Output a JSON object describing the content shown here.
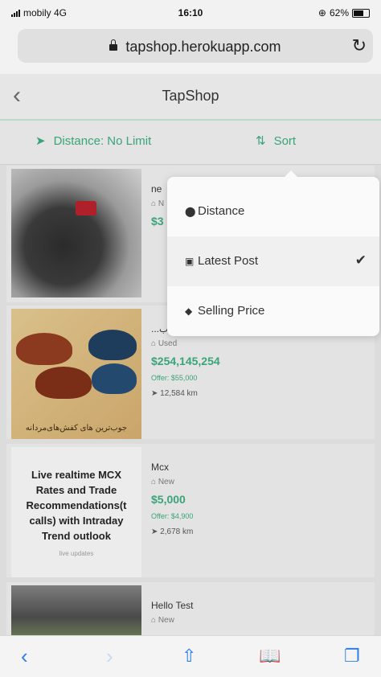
{
  "status": {
    "carrier": "mobily 4G",
    "time": "16:10",
    "battery": "62%"
  },
  "browser": {
    "url": "tapshop.herokuapp.com",
    "reload_icon": "reload-icon"
  },
  "nav": {
    "back_icon": "chevron-left-icon",
    "title": "TapShop"
  },
  "filters": {
    "distance_label": "Distance: No Limit",
    "sort_label": "Sort"
  },
  "sort_menu": {
    "options": [
      {
        "label": "Distance",
        "icon": "location-pin-icon"
      },
      {
        "label": "Latest Post",
        "icon": "calendar-icon",
        "selected": true
      },
      {
        "label": "Selling Price",
        "icon": "tag-icon"
      }
    ]
  },
  "listings": [
    {
      "title": "ne",
      "condition": "N",
      "price": "$3"
    },
    {
      "title": "...لاب",
      "condition": "Used",
      "price": "$254,145,254",
      "offer": "Offer: $55,000",
      "distance": "12,584 km",
      "image_caption": "جوب‌ترین های کفش‌های‌مردانه"
    },
    {
      "title": "Mcx",
      "condition": "New",
      "price": "$5,000",
      "offer": "Offer: $4,900",
      "distance": "2,678 km",
      "image_lines": [
        "Live realtime MCX",
        "Rates and Trade",
        "Recommendations(t",
        "calls) with Intraday",
        "Trend outlook"
      ],
      "image_tag": "live updates"
    },
    {
      "title": "Hello Test",
      "condition": "New"
    }
  ],
  "toolbar": {
    "back": "back-icon",
    "forward": "forward-icon",
    "share": "share-icon",
    "bookmarks": "bookmarks-icon",
    "tabs": "tabs-icon"
  },
  "colors": {
    "accent": "#3aa478",
    "ios_blue": "#2f7ee8"
  }
}
